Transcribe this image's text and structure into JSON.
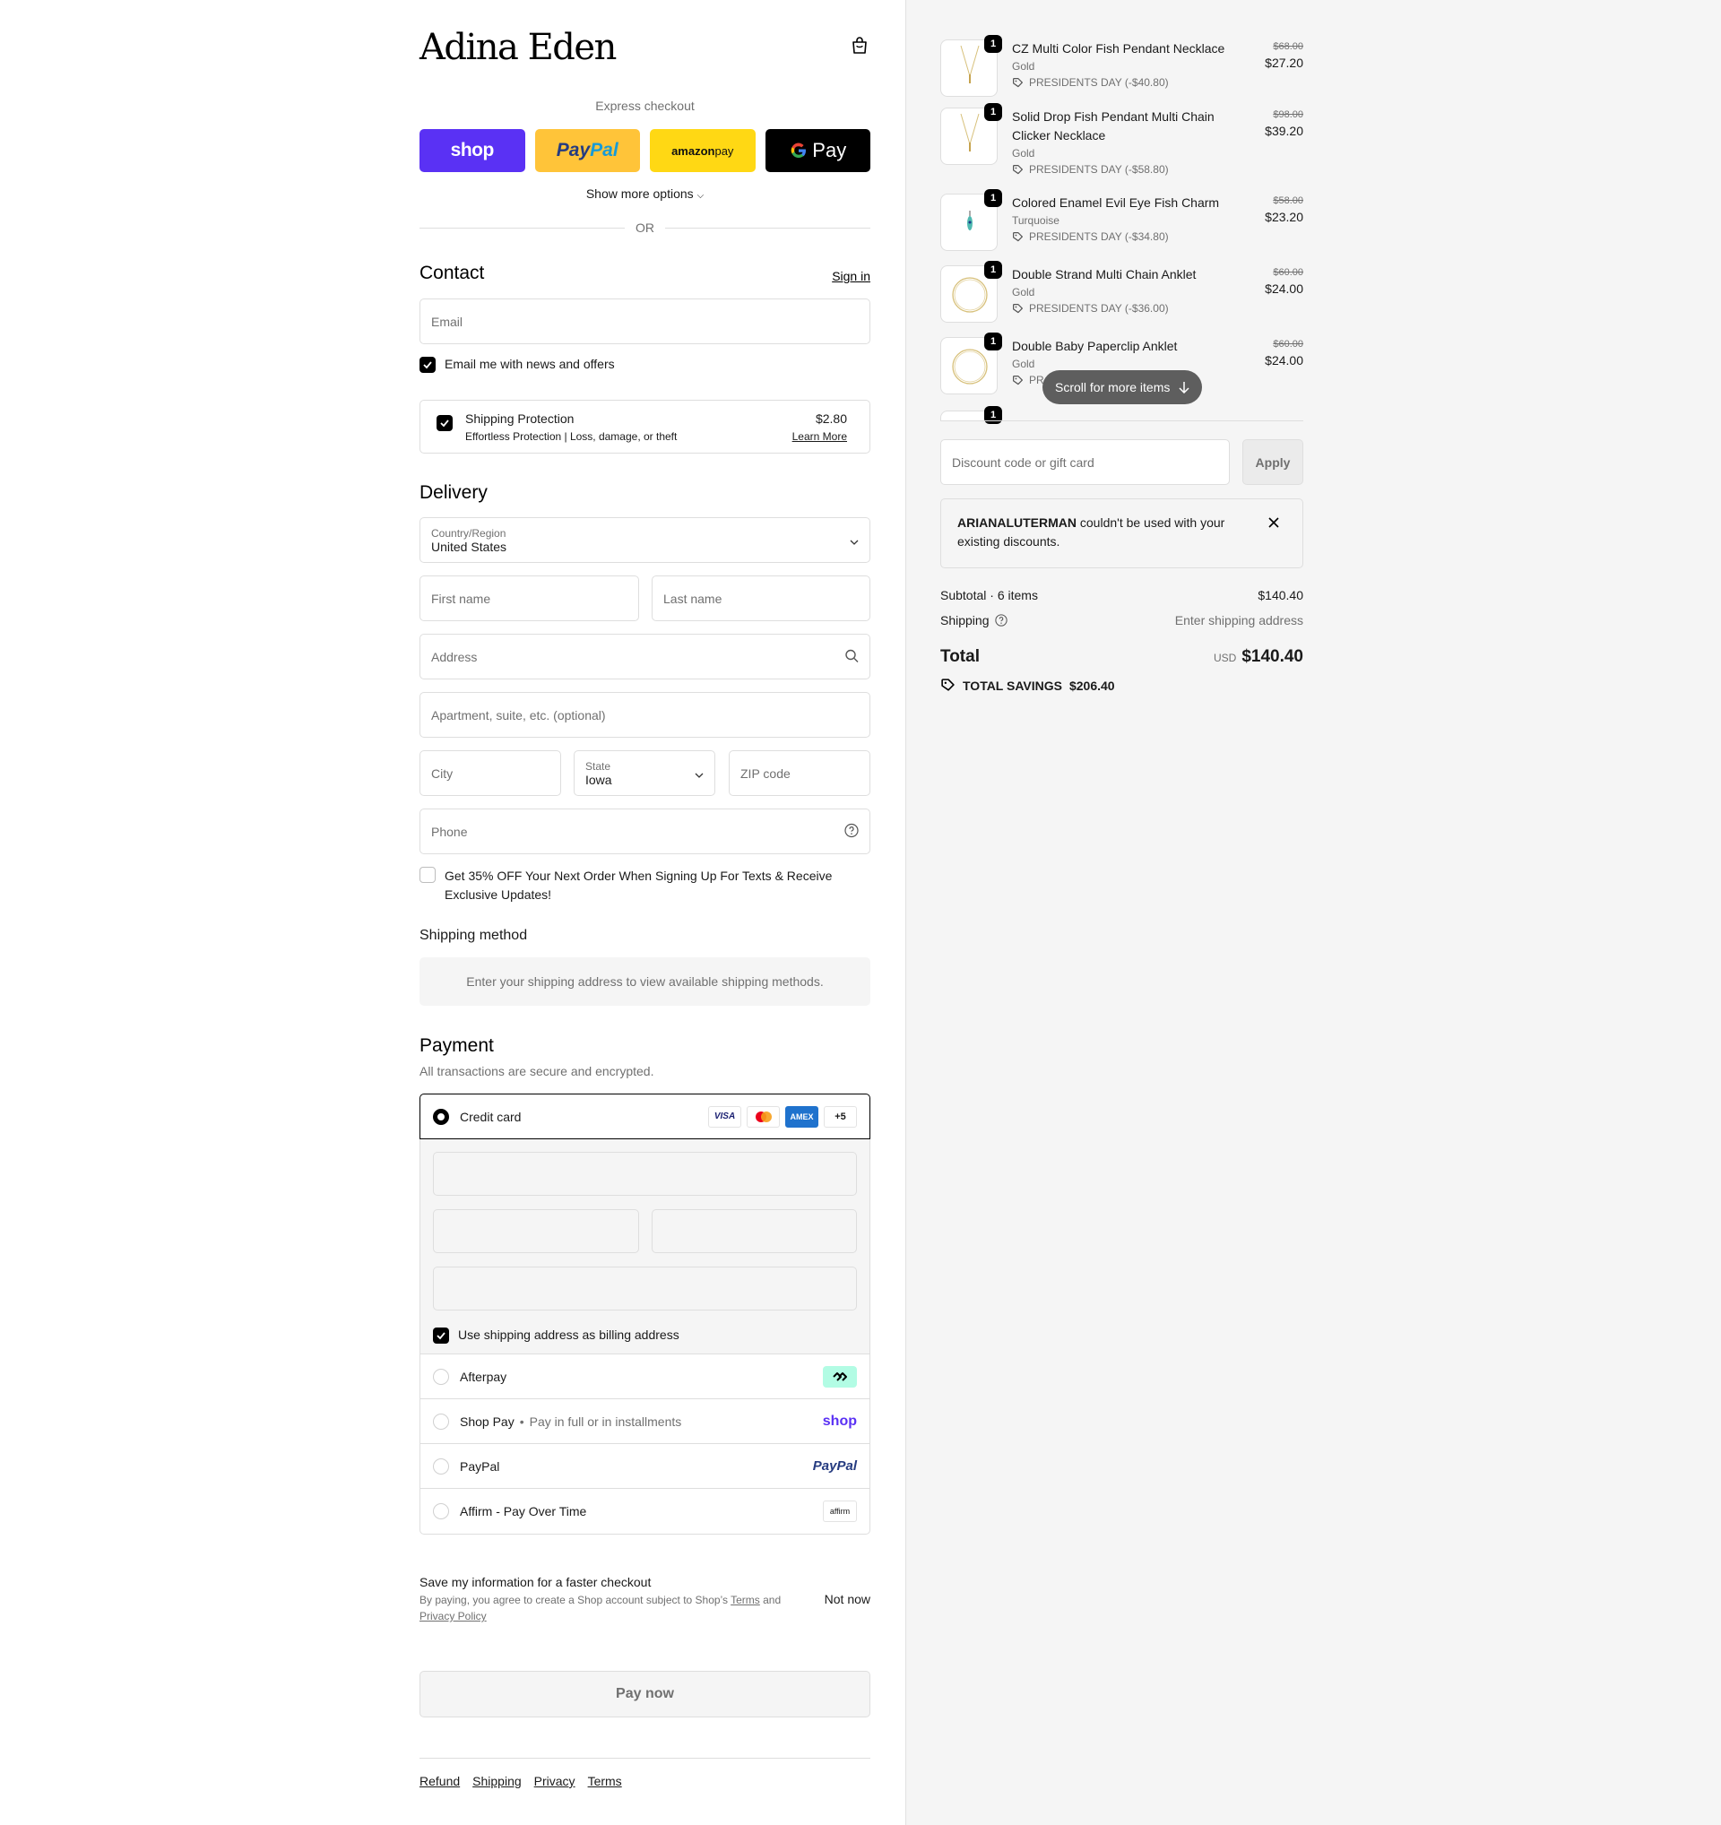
{
  "brand": {
    "logo_text": "Adina Eden"
  },
  "express": {
    "label": "Express checkout",
    "shop": "shop",
    "paypal_1": "Pay",
    "paypal_2": "Pal",
    "amazon_1": "amazon",
    "amazon_2": " pay",
    "gpay": "Pay",
    "show_more": "Show more options",
    "or": "OR"
  },
  "contact": {
    "heading": "Contact",
    "sign_in": "Sign in",
    "email_placeholder": "Email",
    "news_label": "Email me with news and offers",
    "news_checked": true
  },
  "protection": {
    "title": "Shipping Protection",
    "subtitle": "Effortless Protection | Loss, damage, or theft",
    "price": "$2.80",
    "learn_more": "Learn More",
    "checked": true
  },
  "delivery": {
    "heading": "Delivery",
    "country_label": "Country/Region",
    "country_value": "United States",
    "first_name": "First name",
    "last_name": "Last name",
    "address": "Address",
    "apartment": "Apartment, suite, etc. (optional)",
    "city": "City",
    "state_label": "State",
    "state_value": "Iowa",
    "zip": "ZIP code",
    "phone": "Phone",
    "sms_line1": "Get 35% OFF Your Next Order When Signing Up For Texts & Receive",
    "sms_line2": "Exclusive Updates!",
    "sms_checked": false
  },
  "shipping_method": {
    "heading": "Shipping method",
    "notice": "Enter your shipping address to view available shipping methods."
  },
  "payment": {
    "heading": "Payment",
    "subheading": "All transactions are secure and encrypted.",
    "credit_card": "Credit card",
    "card_icons": [
      "VISA",
      "mastercard",
      "AMEX",
      "+5"
    ],
    "billing_same": "Use shipping address as billing address",
    "methods": [
      {
        "label": "Afterpay",
        "sub": "",
        "logo": "afterpay-logo"
      },
      {
        "label": "Shop Pay",
        "sub": "Pay in full or in installments",
        "logo": "shop"
      },
      {
        "label": "PayPal",
        "sub": "",
        "logo": "PayPal"
      },
      {
        "label": "Affirm - Pay Over Time",
        "sub": "",
        "logo": "affirm"
      }
    ],
    "sep": "•"
  },
  "save_info": {
    "title": "Save my information for a faster checkout",
    "legal_1": "By paying, you agree to create a Shop account subject to Shop’s ",
    "terms": "Terms",
    "and": " and",
    "privacy": "Privacy Policy",
    "not_now": "Not now"
  },
  "pay_now": "Pay now",
  "footer": [
    "Refund",
    "Shipping",
    "Privacy",
    "Terms"
  ],
  "cart": {
    "items": [
      {
        "name": "CZ Multi Color Fish Pendant Necklace",
        "variant": "Gold",
        "discount": "PRESIDENTS DAY (-$40.80)",
        "old_price": "$68.00",
        "price": "$27.20",
        "qty": "1",
        "kind": "necklace"
      },
      {
        "name": "Solid Drop Fish Pendant Multi Chain Clicker Necklace",
        "variant": "Gold",
        "discount": "PRESIDENTS DAY (-$58.80)",
        "old_price": "$98.00",
        "price": "$39.20",
        "qty": "1",
        "kind": "necklace"
      },
      {
        "name": "Colored Enamel Evil Eye Fish Charm",
        "variant": "Turquoise",
        "discount": "PRESIDENTS DAY (-$34.80)",
        "old_price": "$58.00",
        "price": "$23.20",
        "qty": "1",
        "kind": "charm"
      },
      {
        "name": "Double Strand Multi Chain Anklet",
        "variant": "Gold",
        "discount": "PRESIDENTS DAY (-$36.00)",
        "old_price": "$60.00",
        "price": "$24.00",
        "qty": "1",
        "kind": "anklet"
      },
      {
        "name": "Double Baby Paperclip Anklet",
        "variant": "Gold",
        "discount": "PR",
        "old_price": "$60.00",
        "price": "$24.00",
        "qty": "1",
        "kind": "anklet"
      }
    ],
    "partial_qty": "1",
    "scroll_hint": "Scroll for more items",
    "discount_placeholder": "Discount code or gift card",
    "apply": "Apply",
    "notice_code": "ARIANALUTERMAN",
    "notice_text": " couldn't be used with your existing discounts.",
    "subtotal_label": "Subtotal · 6 items",
    "subtotal_value": "$140.40",
    "shipping_label": "Shipping",
    "shipping_value": "Enter shipping address",
    "total_label": "Total",
    "currency": "USD",
    "total_value": "$140.40",
    "savings_label": "TOTAL SAVINGS",
    "savings_value": "$206.40"
  },
  "colors": {
    "shop_purple": "#5a31f4",
    "paypal_yellow": "#ffc439",
    "amazon_yellow": "#ffd814",
    "amex_blue": "#1f72cd",
    "afterpay_mint": "#b2fce4"
  }
}
